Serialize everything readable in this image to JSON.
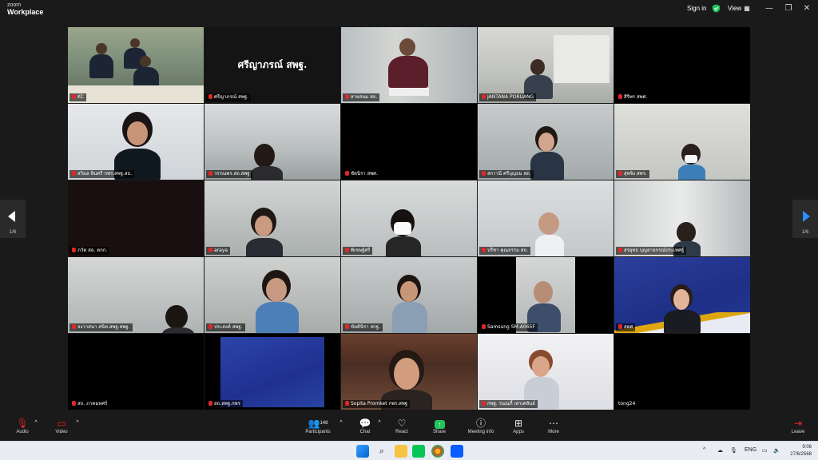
{
  "app": {
    "logo_line1": "zoom",
    "logo_line2": "Workplace"
  },
  "titlebar": {
    "sign_in": "Sign in",
    "view": "View",
    "view_icon": "grid-icon",
    "minimize": "—",
    "restore": "❐",
    "close": "✕"
  },
  "colors": {
    "active_border": "#2bb673",
    "muted_mic": "#e02828",
    "accent_arrow": "#2d8cff",
    "share_green": "#22c55e"
  },
  "pager": {
    "left_label": "1/6",
    "right_label": "1/6"
  },
  "tiles": [
    {
      "name": "KC"
    },
    {
      "name": "ศรีญาภรณ์ สพฐ.",
      "big": "ศรีญาภรณ์ สพฐ."
    },
    {
      "name": "สายสนม สถ."
    },
    {
      "name": "JANTANA PORUANG"
    },
    {
      "name": "สิริพร สพศ."
    },
    {
      "name": "สวิมล อินทรี กพร.สพฐ.สธ."
    },
    {
      "name": "วรรณพร.สถ.สพฐ"
    },
    {
      "name": "ชัดนิรา สพศ."
    },
    {
      "name": "สกาวนี ศรีบุญธม สถ."
    },
    {
      "name": "สุพจิง สพร."
    },
    {
      "name": "ภวัต สอ. ตกก."
    },
    {
      "name": "araya"
    },
    {
      "name": "พิเชษฐ์ศรี"
    },
    {
      "name": "ปรีชา คุณธรรม สถ."
    },
    {
      "name": "สรยุทธ บุญอาจกรณ์ประเทศฐ์"
    },
    {
      "name": "จงวาสนา สนิท.สพฐ.สพฐ."
    },
    {
      "name": "ประสงค์ สพฐ."
    },
    {
      "name": "ขัตตินิรา สกฐ."
    },
    {
      "name": "Samsung SM-A065F"
    },
    {
      "name": "สตศ"
    },
    {
      "name": "สถ. ภาคมหศร์"
    },
    {
      "name": "สถ.สพฐ.กพร"
    },
    {
      "name": "Sopita Promket กพร.สพฐ"
    },
    {
      "name": "กพฐ. รนณภิ์ เสาเค่สันย์"
    },
    {
      "name": "tong24"
    }
  ],
  "toolbar": {
    "audio": "Audio",
    "video": "Video",
    "participants": "Participants",
    "participants_count": "148",
    "chat": "Chat",
    "react": "React",
    "share": "Share",
    "meeting_info": "Meeting info",
    "apps": "Apps",
    "more": "More",
    "leave": "Leave"
  },
  "taskbar": {
    "language": "ENG",
    "time": "9:06",
    "date": "27/6/2568"
  }
}
